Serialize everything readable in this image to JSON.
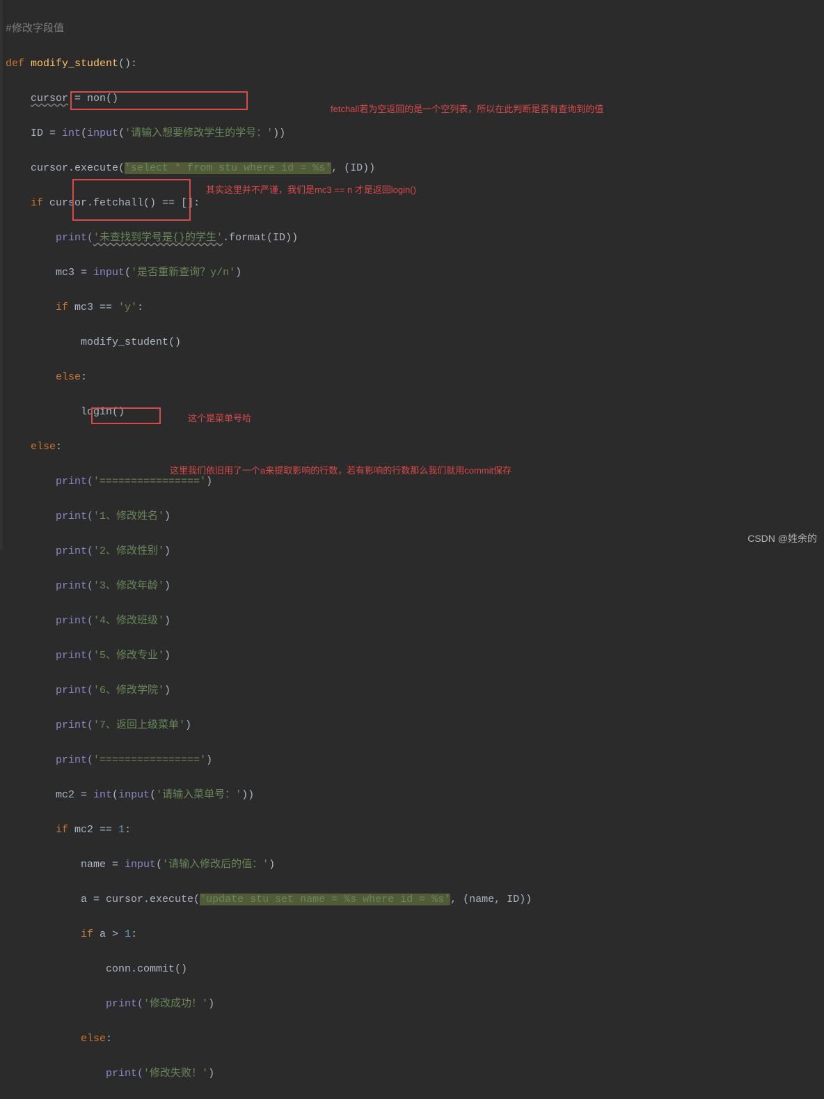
{
  "code": {
    "l1_comment": "#修改字段值",
    "l2_def": "def",
    "l2_name": " modify_student",
    "l2_paren": "():",
    "l3_cursor": "cursor",
    "l3_rest": " = non()",
    "l4_a": "ID = ",
    "l4_int": "int",
    "l4_b": "(",
    "l4_input": "input",
    "l4_c": "(",
    "l4_str": "'请输入想要修改学生的学号：'",
    "l4_d": "))",
    "l5_a": "cursor.execute(",
    "l5_sel": "'select * from stu where id = %s'",
    "l5_b": ", (ID))",
    "l6_if": "if",
    "l6_cond": " cursor.fetchall() == []:",
    "l7_a": "print(",
    "l7_str": "'未查找到学号是{}的学生'",
    "l7_b": ".format(ID))",
    "l8_a": "mc3 = ",
    "l8_input": "input",
    "l8_b": "(",
    "l8_str": "'是否重新查询？y/n'",
    "l8_c": ")",
    "l9_if": "if",
    "l9_a": " mc3 == ",
    "l9_str": "'y'",
    "l9_b": ":",
    "l10": "modify_student()",
    "l11_else": "else",
    "l11_b": ":",
    "l12": "login()",
    "l13_else": "else",
    "l13_b": ":",
    "l14_a": "print(",
    "l14_str": "'================'",
    "l14_b": ")",
    "l15_a": "print(",
    "l15_str": "'1、修改姓名'",
    "l15_b": ")",
    "l16_a": "print(",
    "l16_str": "'2、修改性别'",
    "l16_b": ")",
    "l17_a": "print(",
    "l17_str": "'3、修改年龄'",
    "l17_b": ")",
    "l18_a": "print(",
    "l18_str": "'4、修改班级'",
    "l18_b": ")",
    "l19_a": "print(",
    "l19_str": "'5、修改专业'",
    "l19_b": ")",
    "l20_a": "print(",
    "l20_str": "'6、修改学院'",
    "l20_b": ")",
    "l21_a": "print(",
    "l21_str": "'7、返回上级菜单'",
    "l21_b": ")",
    "l22_a": "print(",
    "l22_str": "'================'",
    "l22_b": ")",
    "l23_a": "mc2 = ",
    "l23_int": "int",
    "l23_b": "(",
    "l23_input": "input",
    "l23_c": "(",
    "l23_str": "'请输入菜单号：'",
    "l23_d": "))",
    "l24_if": "if",
    "l24_a": " mc2 == ",
    "l24_num": "1",
    "l24_b": ":",
    "l25_a": "name = ",
    "l25_input": "input",
    "l25_b": "(",
    "l25_str": "'请输入修改后的值：'",
    "l25_c": ")",
    "l26_a": "a = cursor.execute(",
    "l26_str": "'update stu set name = %s where id = %s'",
    "l26_b": ", (name, ID))",
    "l27_if": "if",
    "l27_a": " a > ",
    "l27_num": "1",
    "l27_b": ":",
    "l28": "conn.commit()",
    "l29_a": "print(",
    "l29_str": "'修改成功！'",
    "l29_b": ")",
    "l30_else": "else",
    "l30_b": ":",
    "l31_a": "print(",
    "l31_str": "'修改失败！'",
    "l31_b": ")"
  },
  "annotations": {
    "a1": "fetchall若为空返回的是一个空列表，所以在此判断是否有查询到的值",
    "a2": "其实这里并不严谨，我们是mc3 == n 才是返回login()",
    "a3": "这个是菜单号哈",
    "a4": "这里我们依旧用了一个a来提取影响的行数，若有影响的行数那么我们就用commit保存"
  },
  "watermark": "CSDN @姓余的"
}
